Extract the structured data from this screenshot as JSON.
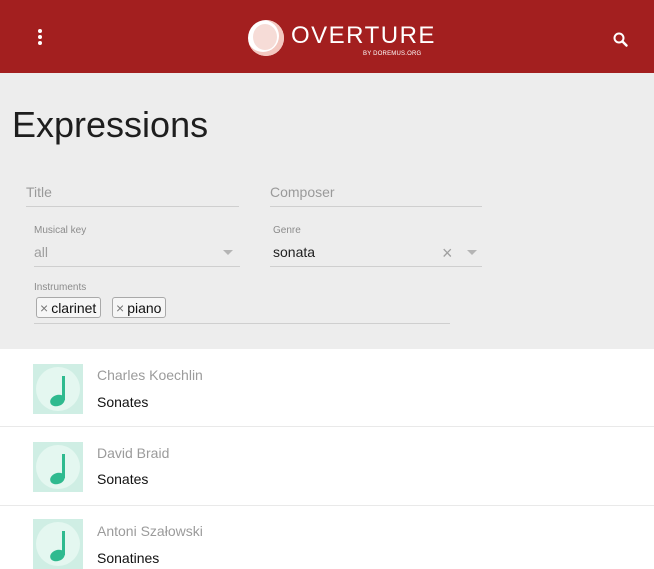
{
  "header": {
    "logo_name": "OVERTURE",
    "logo_sub": "BY DOREMUS.ORG",
    "background": "#a31f1f"
  },
  "page": {
    "title": "Expressions"
  },
  "filters": {
    "title": {
      "label": "Title",
      "value": ""
    },
    "composer": {
      "label": "Composer",
      "value": ""
    },
    "musical_key": {
      "label": "Musical key",
      "value": "all"
    },
    "genre": {
      "label": "Genre",
      "value": "sonata"
    },
    "instruments": {
      "label": "Instruments",
      "chips": [
        "clarinet",
        "piano"
      ]
    }
  },
  "results": [
    {
      "composer": "Charles Koechlin",
      "title": "Sonates",
      "icon": "music-note-icon"
    },
    {
      "composer": "David Braid",
      "title": "Sonates",
      "icon": "music-note-icon"
    },
    {
      "composer": "Antoni Szałowski",
      "title": "Sonatines",
      "icon": "music-note-icon"
    }
  ],
  "colors": {
    "accent": "#a31f1f",
    "note": "#2fba8f"
  }
}
